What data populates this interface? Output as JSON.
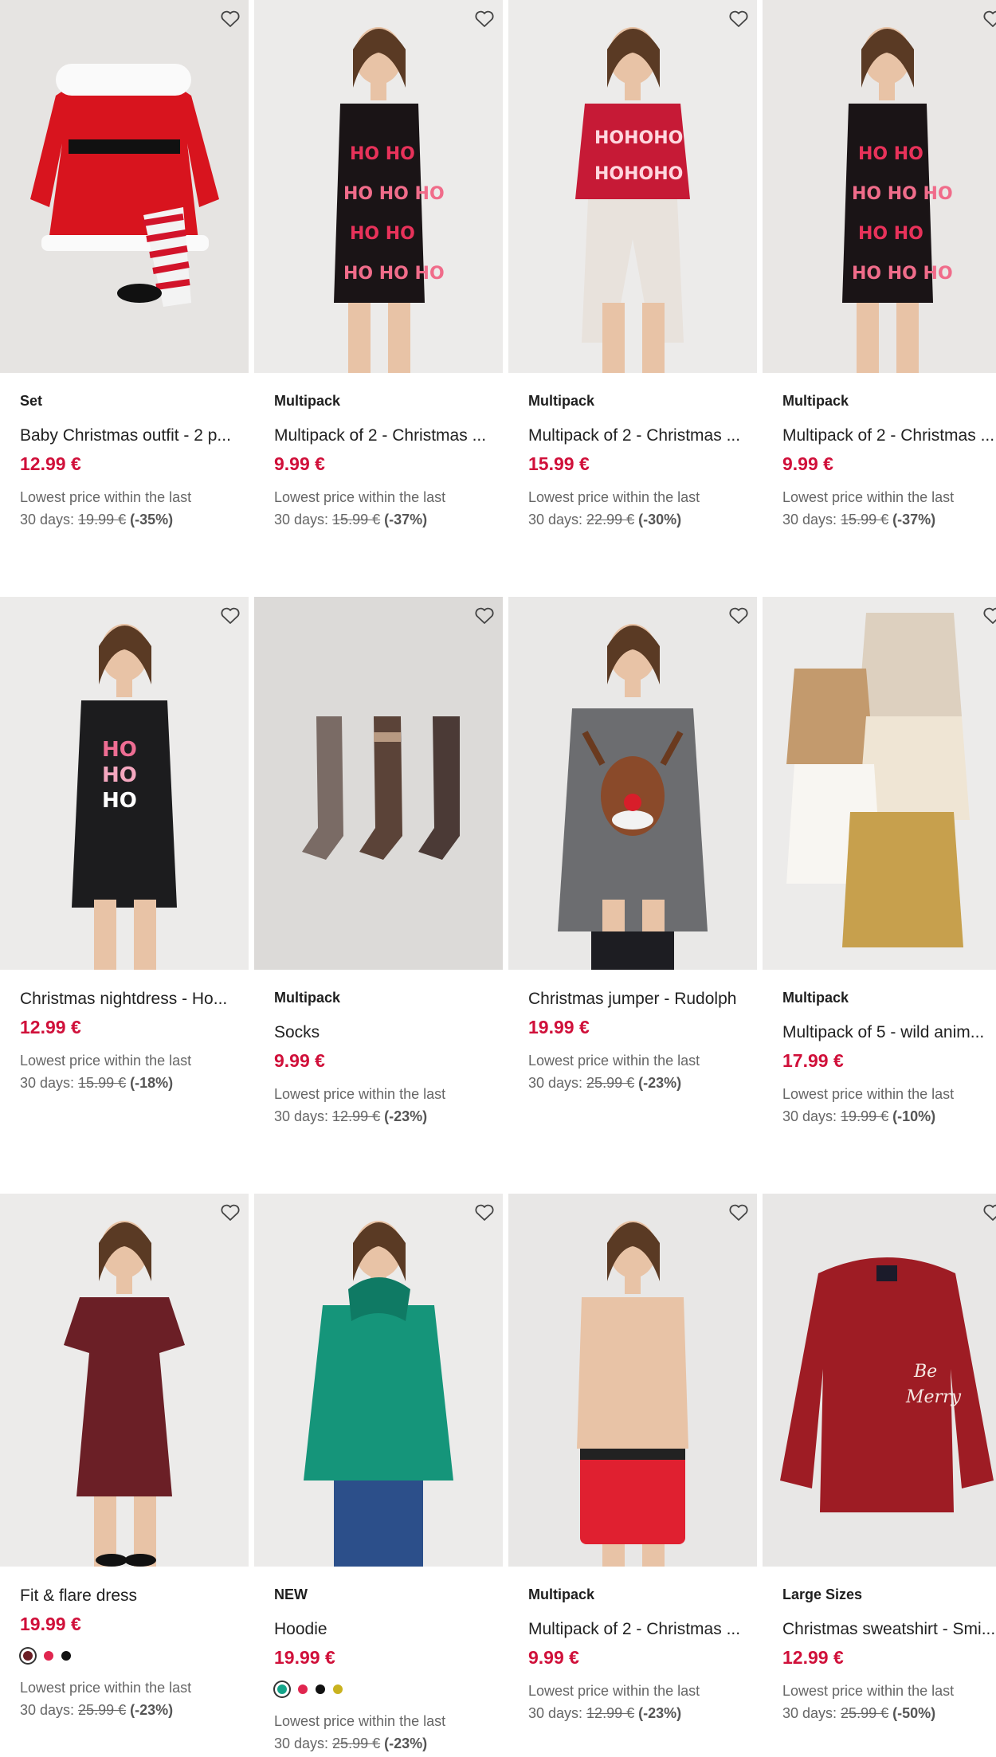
{
  "colors": {
    "price": "#d0103a",
    "text": "#1e1e1e",
    "muted": "#666666"
  },
  "products": [
    {
      "badge": "Set",
      "title": "Baby Christmas outfit - 2 p...",
      "price": "12.99 €",
      "lowest_line1": "Lowest price within the last",
      "lowest_days": "30 days: ",
      "old_price": "19.99 €",
      "discount": " (-35%)"
    },
    {
      "badge": "Multipack",
      "title": "Multipack of 2 - Christmas ...",
      "price": "9.99 €",
      "lowest_line1": "Lowest price within the last",
      "lowest_days": "30 days: ",
      "old_price": "15.99 €",
      "discount": " (-37%)"
    },
    {
      "badge": "Multipack",
      "title": "Multipack of 2 - Christmas ...",
      "price": "15.99 €",
      "lowest_line1": "Lowest price within the last",
      "lowest_days": "30 days: ",
      "old_price": "22.99 €",
      "discount": " (-30%)"
    },
    {
      "badge": "Multipack",
      "title": "Multipack of 2 - Christmas ...",
      "price": "9.99 €",
      "lowest_line1": "Lowest price within the last",
      "lowest_days": "30 days: ",
      "old_price": "15.99 €",
      "discount": " (-37%)"
    },
    {
      "badge": "",
      "title": "Christmas nightdress - Ho...",
      "price": "12.99 €",
      "lowest_line1": "Lowest price within the last",
      "lowest_days": "30 days: ",
      "old_price": "15.99 €",
      "discount": " (-18%)"
    },
    {
      "badge": "Multipack",
      "title": "Socks",
      "price": "9.99 €",
      "lowest_line1": "Lowest price within the last",
      "lowest_days": "30 days: ",
      "old_price": "12.99 €",
      "discount": " (-23%)"
    },
    {
      "badge": "",
      "title": "Christmas jumper - Rudolph",
      "price": "19.99 €",
      "lowest_line1": "Lowest price within the last",
      "lowest_days": "30 days: ",
      "old_price": "25.99 €",
      "discount": " (-23%)"
    },
    {
      "badge": "Multipack",
      "title": "Multipack of 5 - wild anim...",
      "price": "17.99 €",
      "lowest_line1": "Lowest price within the last",
      "lowest_days": "30 days: ",
      "old_price": "19.99 €",
      "discount": " (-10%)"
    },
    {
      "badge": "",
      "title": "Fit & flare dress",
      "price": "19.99 €",
      "swatches": [
        "#6b1f26",
        "#e0264f",
        "#111111"
      ],
      "lowest_line1": "Lowest price within the last",
      "lowest_days": "30 days: ",
      "old_price": "25.99 €",
      "discount": " (-23%)"
    },
    {
      "badge": "NEW",
      "title": "Hoodie",
      "price": "19.99 €",
      "swatches": [
        "#14a58a",
        "#e0264f",
        "#111111",
        "#c9b21f"
      ],
      "lowest_line1": "Lowest price within the last",
      "lowest_days": "30 days: ",
      "old_price": "25.99 €",
      "discount": " (-23%)"
    },
    {
      "badge": "Multipack",
      "title": "Multipack of 2 - Christmas ...",
      "price": "9.99 €",
      "lowest_line1": "Lowest price within the last",
      "lowest_days": "30 days: ",
      "old_price": "12.99 €",
      "discount": " (-23%)"
    },
    {
      "badge": "Large Sizes",
      "title": "Christmas sweatshirt - Smi...",
      "price": "12.99 €",
      "lowest_line1": "Lowest price within the last",
      "lowest_days": "30 days: ",
      "old_price": "25.99 €",
      "discount": " (-50%)"
    }
  ],
  "product_images": [
    {
      "icon": "baby-christmas-outfit-image",
      "bg": "#e6e4e2",
      "main": "#d8141e"
    },
    {
      "icon": "ho-print-pyjama-image",
      "bg": "#ecebea",
      "main": "#1a1416"
    },
    {
      "icon": "ho-print-pyjama-set-image",
      "bg": "#ecebea",
      "main": "#c61a36"
    },
    {
      "icon": "ho-print-camisole-image",
      "bg": "#e9e7e5",
      "main": "#1a1416"
    },
    {
      "icon": "ho-nightdress-image",
      "bg": "#ecebea",
      "main": "#1c1c1e"
    },
    {
      "icon": "socks-image",
      "bg": "#dcdad8",
      "main": "#5a4a44"
    },
    {
      "icon": "rudolph-jumper-image",
      "bg": "#e9e8e7",
      "main": "#6c6d70"
    },
    {
      "icon": "baby-bodysuits-image",
      "bg": "#ecebea",
      "main": "#c7a04d"
    },
    {
      "icon": "burgundy-dress-image",
      "bg": "#ecebea",
      "main": "#6b1f26"
    },
    {
      "icon": "green-hoodie-image",
      "bg": "#ecebea",
      "main": "#15957a"
    },
    {
      "icon": "christmas-boxers-image",
      "bg": "#e8e7e6",
      "main": "#e02030"
    },
    {
      "icon": "red-sweatshirt-image",
      "bg": "#e8e7e6",
      "main": "#9e1c24"
    }
  ]
}
